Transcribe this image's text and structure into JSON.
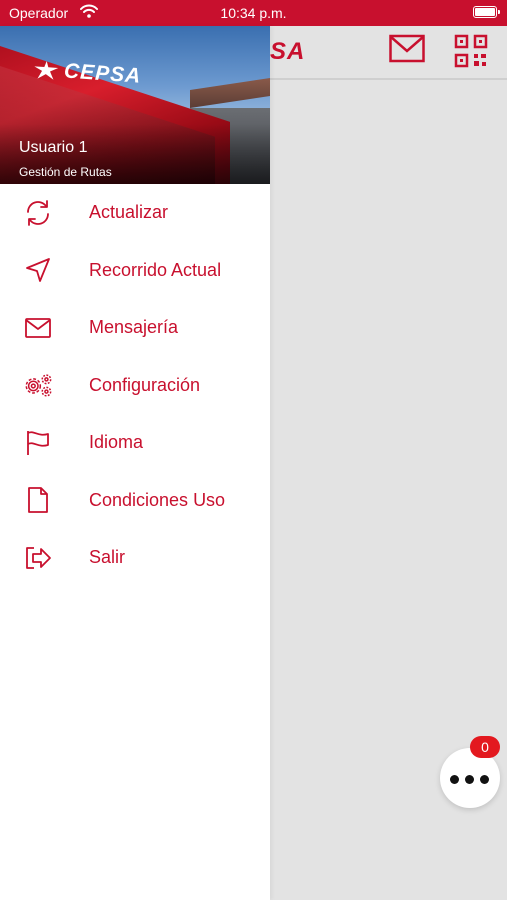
{
  "status_bar": {
    "carrier": "Operador",
    "time": "10:34 p.m.",
    "wifi_icon": "wifi-icon",
    "battery_icon": "battery-icon"
  },
  "header": {
    "logo_fragment": "SA",
    "mail_icon": "mail-icon",
    "qr_icon": "qr-code-icon"
  },
  "drawer": {
    "brand": "CEPSA",
    "user_name": "Usuario 1",
    "user_role": "Gestión de Rutas",
    "menu": [
      {
        "label": "Actualizar",
        "icon": "refresh-icon"
      },
      {
        "label": "Recorrido Actual",
        "icon": "navigation-arrow-icon"
      },
      {
        "label": "Mensajería",
        "icon": "mail-icon"
      },
      {
        "label": "Configuración",
        "icon": "gears-icon"
      },
      {
        "label": "Idioma",
        "icon": "flag-icon"
      },
      {
        "label": "Condiciones Uso",
        "icon": "document-icon"
      },
      {
        "label": "Salir",
        "icon": "logout-icon"
      }
    ]
  },
  "fab": {
    "icon": "more-dots-icon",
    "badge_count": "0"
  },
  "colors": {
    "accent": "#c8102e",
    "badge": "#e3191f",
    "background": "#e3e3e3"
  }
}
